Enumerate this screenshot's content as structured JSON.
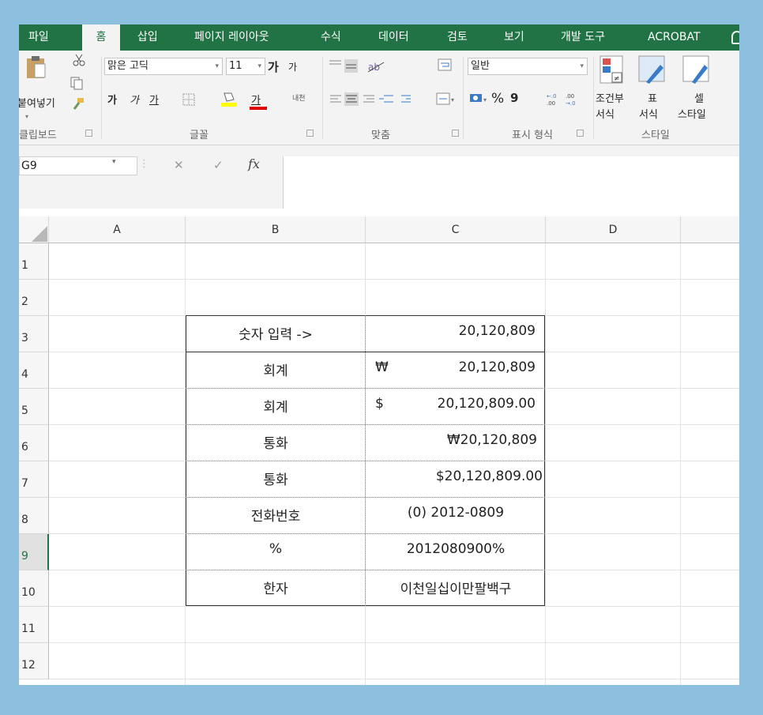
{
  "ribbon_tabs": [
    "파일",
    "홈",
    "삽입",
    "페이지 레이아웃",
    "수식",
    "데이터",
    "검토",
    "보기",
    "개발 도구",
    "ACROBAT"
  ],
  "active_tab": "홈",
  "ribbon": {
    "paste_label": "붙여넣기",
    "font_name": "맑은 고딕",
    "font_size": "11",
    "grow_font": "가",
    "shrink_font": "가",
    "bold": "가",
    "italic": "가",
    "underline": "가",
    "font_color": "가",
    "phonetic": "내천",
    "number_format": "일반",
    "percent": "%",
    "comma": "9",
    "conditional_format": [
      "조건부",
      "서식"
    ],
    "format_table": [
      "표",
      "서식"
    ],
    "cell_style": [
      "셀",
      "스타일"
    ],
    "groups": {
      "clipboard": "클립보드",
      "font": "글꼴",
      "alignment": "맞춤",
      "number": "표시 형식",
      "styles": "스타일"
    }
  },
  "formula_bar": {
    "name_box": "G9",
    "cancel": "✕",
    "enter": "✓",
    "fx": "fx",
    "value": ""
  },
  "columns": [
    "A",
    "B",
    "C",
    "D"
  ],
  "rows": [
    "1",
    "2",
    "3",
    "4",
    "5",
    "6",
    "7",
    "8",
    "9",
    "10",
    "11",
    "12"
  ],
  "selected_row": "9",
  "table": [
    {
      "label": "숫자 입력 ->",
      "symbol": "",
      "value": "20,120,809"
    },
    {
      "label": "회계",
      "symbol": "₩",
      "value": "20,120,809"
    },
    {
      "label": "회계",
      "symbol": "$",
      "value": "20,120,809.00"
    },
    {
      "label": "통화",
      "symbol": "",
      "value": "₩20,120,809"
    },
    {
      "label": "통화",
      "symbol": "",
      "value": "$20,120,809.00"
    },
    {
      "label": "전화번호",
      "symbol": "",
      "value": "(0) 2012-0809"
    },
    {
      "label": "%",
      "symbol": "",
      "value": "2012080900%"
    },
    {
      "label": "한자",
      "symbol": "",
      "value": "이천일십이만팔백구"
    }
  ]
}
